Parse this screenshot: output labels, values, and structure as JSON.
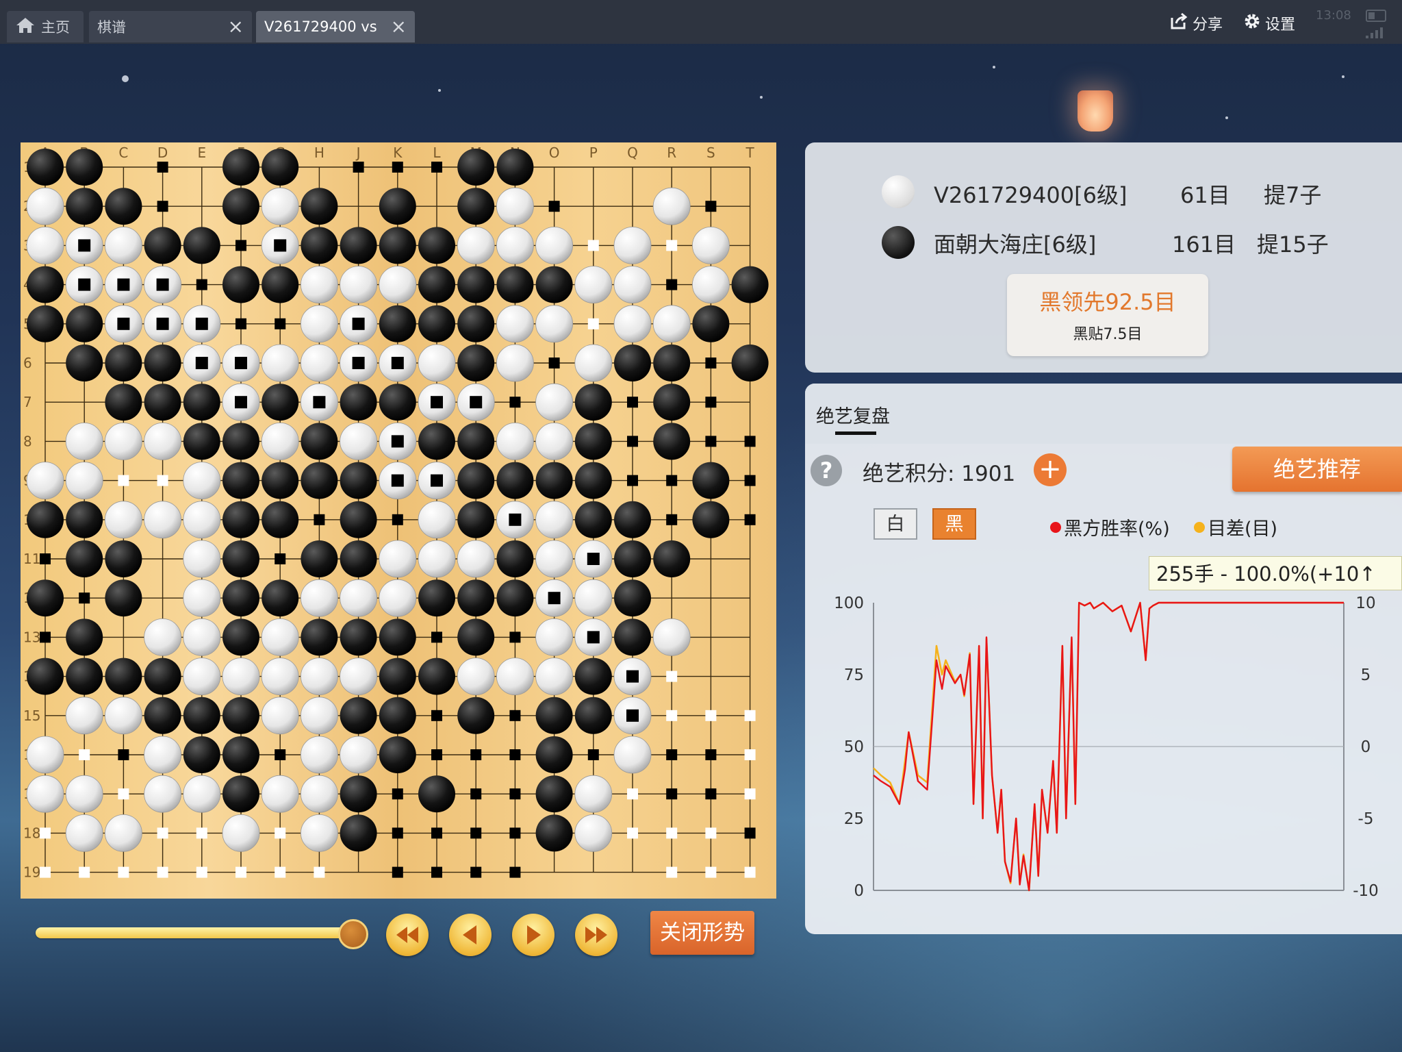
{
  "tabs": {
    "home": {
      "label": "主页"
    },
    "qipu": {
      "label": "棋谱"
    },
    "game": {
      "label": "V261729400 vs"
    }
  },
  "toolbar": {
    "share_label": "分享",
    "settings_label": "设置"
  },
  "status": {
    "time": "13:08"
  },
  "board": {
    "size": 19,
    "col_labels": [
      "A",
      "B",
      "C",
      "D",
      "E",
      "F",
      "G",
      "H",
      "J",
      "K",
      "L",
      "M",
      "N",
      "O",
      "P",
      "Q",
      "R",
      "S",
      "T"
    ],
    "row_labels": [
      "1",
      "2",
      "3",
      "4",
      "5",
      "6",
      "7",
      "8",
      "9",
      "10",
      "11",
      "12",
      "13",
      "14",
      "15",
      "16",
      "17",
      "18",
      "19"
    ],
    "rows": [
      "BB.x.BB.xxxBB......",
      "WBBx.BWB.B.BWx..Wx.",
      "WWWBBxWBBBBWWWoWoW.",
      "BWWWxBBWWWBBBBWWxWB",
      "BBWWWxxWWBBBWWoWWB.",
      ".BBBWWWWWWWBWxWBBxB",
      "..BBBWBWBBWWxWBxBx.",
      ".WWWBBWBWWBBWWBxBxx",
      "WWooWBBBBWWBBBBxxBx",
      "BBWWWBBxBxWBWWBBxBx",
      "xBB.WBxBBWWWBWWBB..",
      "BxB.WBBWWWBBBWWB...",
      "xB.WWBWBBBxBxWWBW..",
      "BBBBWWWWWBBWWWBWo..",
      ".WWBBBWWBBxBxBBWooo",
      "WoxWBBxWWBxxxBxWxxo",
      "WWoWWBWWBxBxxBWoxxo",
      "oWWooWoWBxxxxBWooox",
      "oooooooo.xxxx...ooo"
    ],
    "marked_white_stones": [
      "2,1",
      "2,6",
      "3,1",
      "3,2",
      "3,3",
      "3,6",
      "4,2",
      "4,3",
      "4,4",
      "4,8",
      "4,9",
      "4,10",
      "5,3",
      "5,4",
      "5,5",
      "5,8",
      "5,9",
      "6,5",
      "6,6",
      "6,7",
      "6,8",
      "6,9",
      "6,10",
      "6,11",
      "7,7",
      "7,9",
      "8,7",
      "8,9",
      "8,10",
      "9,11",
      "9,12",
      "10,12",
      "10,14",
      "11,11",
      "11,12",
      "11,13",
      "11,15",
      "12,8",
      "12,9",
      "12,10",
      "12,14",
      "13,14",
      "13,15",
      "14,13",
      "14,14",
      "14,15"
    ],
    "marked_black_stones": [
      "17,1"
    ],
    "last_move": "18,14"
  },
  "players": {
    "white": {
      "name": "V261729400[6级]",
      "territory": "61目",
      "captures": "提7子"
    },
    "black": {
      "name": "面朝大海庄[6级]",
      "territory": "161目",
      "captures": "提15子"
    }
  },
  "result": {
    "lead": "黑领先92.5目",
    "komi": "黑贴7.5目"
  },
  "analysis": {
    "tab_label": "绝艺复盘",
    "score_label": "绝艺积分: 1901",
    "recommend_label": "绝艺推荐",
    "white_btn": "白",
    "black_btn": "黑",
    "legend_winrate": "黑方胜率(%)",
    "legend_diff": "目差(目)",
    "tooltip": "255手 - 100.0%(+10↑"
  },
  "controls": {
    "close_label": "关闭形势",
    "progress": 1.0
  },
  "colors": {
    "accent": "#e9822f",
    "winrate_line": "#e8141a",
    "diff_line": "#f5b21c"
  },
  "chart_data": {
    "type": "line",
    "title": "",
    "xlabel": "",
    "ylabel": "",
    "x_range": [
      1,
      255
    ],
    "ylim": [
      0,
      100
    ],
    "y2lim": [
      -10,
      10
    ],
    "y_ticks": [
      0,
      25,
      50,
      75,
      100
    ],
    "y2_ticks": [
      -10,
      -5,
      0,
      5,
      10
    ],
    "series": [
      {
        "name": "黑方胜率(%)",
        "axis": "left",
        "x": [
          1,
          5,
          10,
          15,
          18,
          20,
          25,
          30,
          35,
          38,
          40,
          45,
          48,
          50,
          53,
          55,
          58,
          60,
          62,
          65,
          68,
          70,
          72,
          75,
          78,
          80,
          82,
          85,
          88,
          90,
          92,
          95,
          98,
          100,
          103,
          105,
          108,
          110,
          112,
          115,
          118,
          120,
          125,
          130,
          135,
          140,
          145,
          148,
          150,
          152,
          155,
          160,
          170,
          180,
          200,
          220,
          240,
          255
        ],
        "y": [
          40,
          38,
          36,
          30,
          42,
          55,
          38,
          35,
          80,
          70,
          78,
          72,
          75,
          68,
          82,
          30,
          85,
          25,
          88,
          40,
          20,
          35,
          10,
          3,
          25,
          2,
          12,
          0,
          30,
          5,
          35,
          20,
          45,
          20,
          85,
          25,
          88,
          30,
          100,
          99,
          100,
          98,
          100,
          97,
          99,
          90,
          100,
          80,
          98,
          99,
          100,
          100,
          100,
          100,
          100,
          100,
          100,
          100
        ]
      },
      {
        "name": "目差(目)",
        "axis": "right",
        "x": [
          1,
          5,
          10,
          15,
          18,
          20,
          25,
          30,
          35,
          38,
          40,
          45,
          48,
          50,
          53,
          55,
          58,
          60,
          62,
          65,
          68,
          70,
          72,
          75,
          78,
          80,
          82,
          85,
          88,
          90,
          92,
          95,
          98,
          100,
          103,
          105,
          108,
          110,
          112,
          115,
          118,
          120,
          125,
          130,
          135,
          140,
          145,
          148,
          150,
          152,
          155,
          160,
          170,
          180,
          200,
          220,
          240,
          255
        ],
        "y": [
          -1.5,
          -2,
          -2.5,
          -4,
          -1,
          1,
          -2,
          -2.5,
          7,
          5,
          6,
          4.5,
          5,
          3.5,
          6.5,
          -4,
          7,
          -5,
          7.5,
          -2,
          -6,
          -3,
          -8,
          -9.5,
          -5,
          -9.5,
          -7.5,
          -10,
          -4,
          -9,
          -3,
          -6,
          -1,
          -6,
          7,
          -5,
          7.5,
          -4,
          10,
          9.8,
          10,
          9.6,
          10,
          9.4,
          9.8,
          8,
          10,
          6,
          9.6,
          9.8,
          10,
          10,
          10,
          10,
          10,
          10,
          10,
          10
        ]
      }
    ]
  }
}
